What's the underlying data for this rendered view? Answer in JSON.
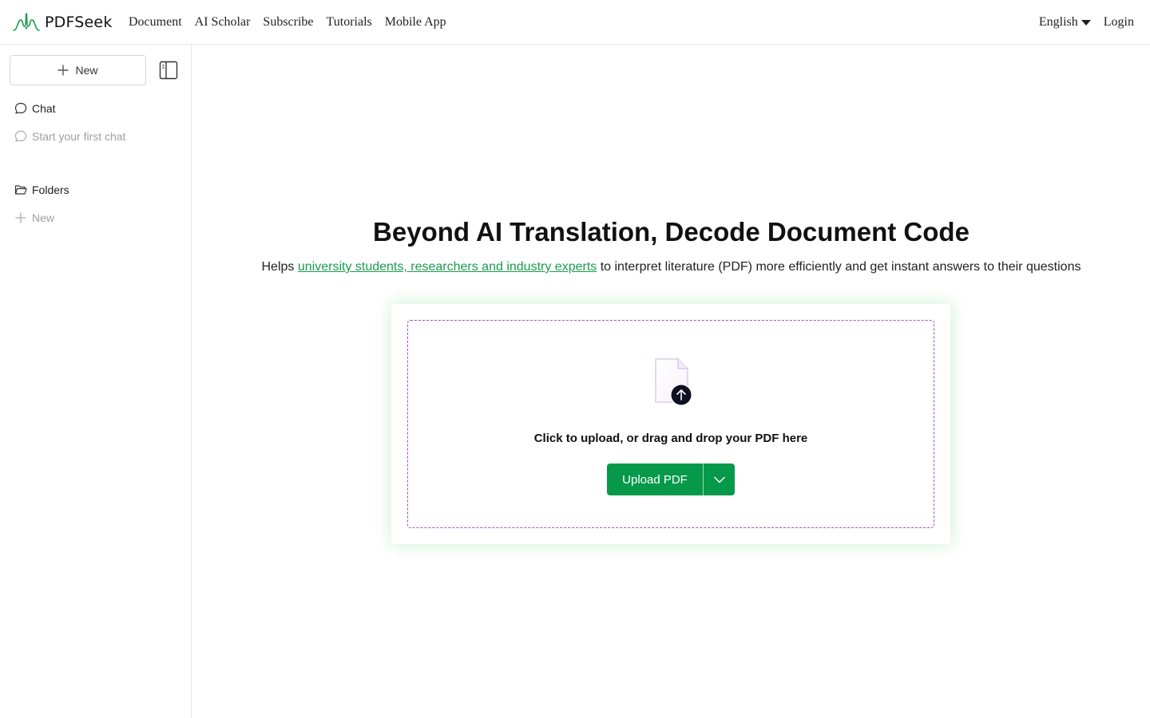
{
  "header": {
    "brand": "PDFSeek",
    "nav": [
      "Document",
      "AI Scholar",
      "Subscribe",
      "Tutorials",
      "Mobile App"
    ],
    "language": "English",
    "login": "Login"
  },
  "sidebar": {
    "new_label": "New",
    "chat_label": "Chat",
    "chat_empty": "Start your first chat",
    "folders_label": "Folders",
    "folders_new": "New"
  },
  "hero": {
    "title": "Beyond AI Translation, Decode Document Code",
    "sub_prefix": "Helps ",
    "sub_link": "university students, researchers and industry experts",
    "sub_suffix": " to interpret literature (PDF) more efficiently and get instant answers to their questions"
  },
  "upload": {
    "drop_text": "Click to upload, or drag and drop your PDF here",
    "button_label": "Upload PDF"
  },
  "colors": {
    "accent": "#07994a",
    "link": "#1a9b4e",
    "dropzone_border": "#a54ad0",
    "card_glow": "#3cbe5a"
  },
  "icons": [
    "brand-logo-icon",
    "plus-icon",
    "sidebar-toggle-icon",
    "chat-bubble-icon",
    "folder-open-icon",
    "file-upload-icon",
    "upload-arrow-icon",
    "chevron-down-icon",
    "caret-down-icon"
  ]
}
